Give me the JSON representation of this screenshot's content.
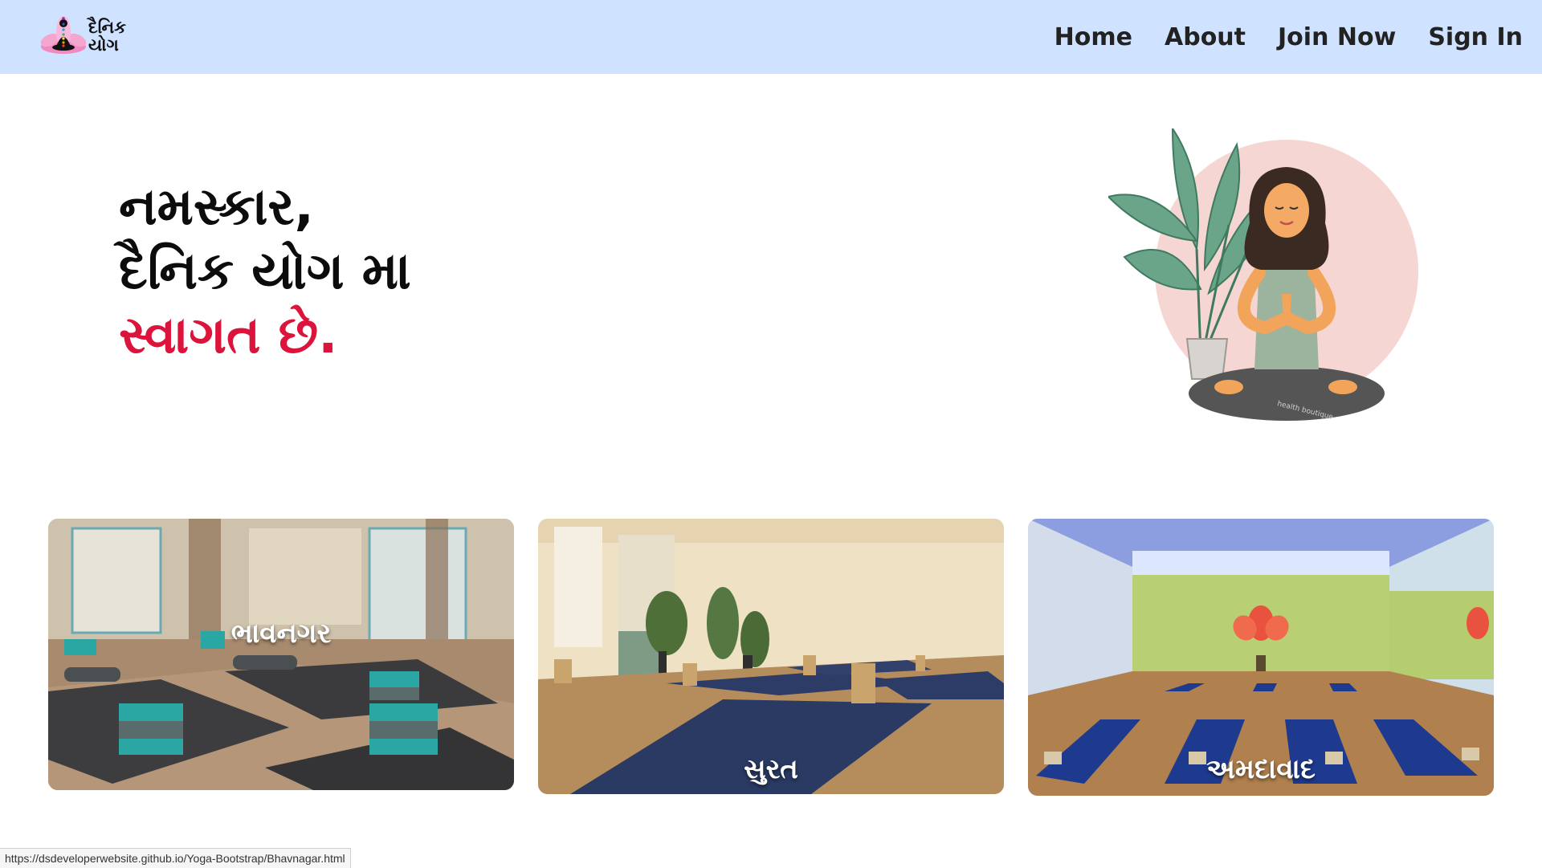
{
  "brand": {
    "logo_line1": "દૈનિક",
    "logo_line2": "યોગ",
    "logo_icon": "lotus-meditation-logo-icon"
  },
  "nav": {
    "items": [
      {
        "label": "Home"
      },
      {
        "label": "About"
      },
      {
        "label": "Join Now"
      },
      {
        "label": "Sign In"
      }
    ]
  },
  "hero": {
    "line1": "નમસ્કાર,",
    "line2": "દૈનિક યોગ મા",
    "line3": "સ્વાગત છે.",
    "illustration_caption": "health boutique",
    "accent_color": "#dc143c"
  },
  "cities": [
    {
      "label": "ભાવનગર",
      "link": "https://dsdeveloperwebsite.github.io/Yoga-Bootstrap/Bhavnagar.html"
    },
    {
      "label": "સુરત"
    },
    {
      "label": "અમદાવાદ"
    }
  ],
  "status_bar": {
    "url": "https://dsdeveloperwebsite.github.io/Yoga-Bootstrap/Bhavnagar.html"
  },
  "colors": {
    "navbar_bg": "#cfe2ff",
    "hero_text": "#0c0c0c",
    "hero_accent": "#dc143c"
  }
}
